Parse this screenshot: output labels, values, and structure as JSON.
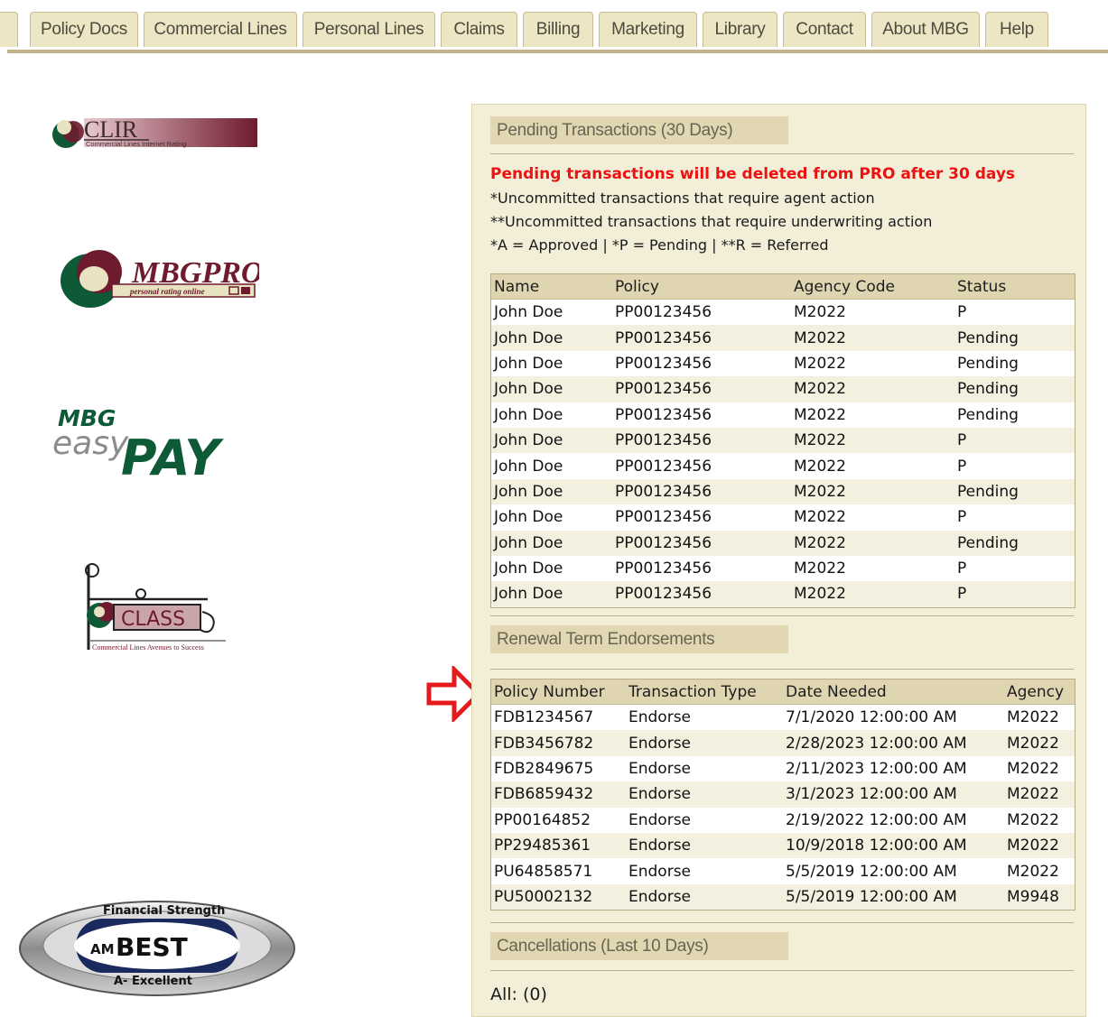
{
  "nav": {
    "tabs": [
      "Policy Docs",
      "Commercial Lines",
      "Personal Lines",
      "Claims",
      "Billing",
      "Marketing",
      "Library",
      "Contact",
      "About MBG",
      "Help"
    ]
  },
  "logos": {
    "clir": {
      "name": "CLIR",
      "tagline": "Commercial Lines Internet Rating"
    },
    "mbgpro": {
      "name": "MBGPRO",
      "tagline": "personal rating online"
    },
    "easypay": {
      "top": "MBG",
      "middle": "easy",
      "bottom": "PAY"
    },
    "class": {
      "name": "CLASS",
      "tagline": "Commercial Lines Avenues to Success"
    },
    "ambest": {
      "top": "Financial Strength",
      "name": "BEST",
      "bottom": "A- Excellent"
    }
  },
  "pending": {
    "title": "Pending Transactions (30 Days)",
    "warning": "Pending transactions will be deleted from PRO after 30 days",
    "note1": "*Uncommitted transactions that require agent action",
    "note2": "**Uncommitted transactions that require underwriting action",
    "note3": "*A = Approved | *P = Pending | **R = Referred",
    "columns": [
      "Name",
      "Policy",
      "Agency Code",
      "Status"
    ],
    "rows": [
      [
        "John Doe",
        "PP00123456",
        "M2022",
        "P"
      ],
      [
        "John Doe",
        "PP00123456",
        "M2022",
        "Pending"
      ],
      [
        "John Doe",
        "PP00123456",
        "M2022",
        "Pending"
      ],
      [
        "John Doe",
        "PP00123456",
        "M2022",
        "Pending"
      ],
      [
        "John Doe",
        "PP00123456",
        "M2022",
        "Pending"
      ],
      [
        "John Doe",
        "PP00123456",
        "M2022",
        "P"
      ],
      [
        "John Doe",
        "PP00123456",
        "M2022",
        "P"
      ],
      [
        "John Doe",
        "PP00123456",
        "M2022",
        "Pending"
      ],
      [
        "John Doe",
        "PP00123456",
        "M2022",
        "P"
      ],
      [
        "John Doe",
        "PP00123456",
        "M2022",
        "Pending"
      ],
      [
        "John Doe",
        "PP00123456",
        "M2022",
        "P"
      ],
      [
        "John Doe",
        "PP00123456",
        "M2022",
        "P"
      ]
    ]
  },
  "renewal": {
    "title": "Renewal Term Endorsements",
    "columns": [
      "Policy Number",
      "Transaction Type",
      "Date Needed",
      "Agency"
    ],
    "rows": [
      [
        "FDB1234567",
        "Endorse",
        "7/1/2020 12:00:00 AM",
        "M2022"
      ],
      [
        "FDB3456782",
        "Endorse",
        "2/28/2023 12:00:00 AM",
        "M2022"
      ],
      [
        "FDB2849675",
        "Endorse",
        "2/11/2023 12:00:00 AM",
        "M2022"
      ],
      [
        "FDB6859432",
        "Endorse",
        "3/1/2023 12:00:00 AM",
        "M2022"
      ],
      [
        "PP00164852",
        "Endorse",
        "2/19/2022 12:00:00 AM",
        "M2022"
      ],
      [
        "PP29485361",
        "Endorse",
        "10/9/2018 12:00:00 AM",
        "M2022"
      ],
      [
        "PU64858571",
        "Endorse",
        "5/5/2019 12:00:00 AM",
        "M2022"
      ],
      [
        "PU50002132",
        "Endorse",
        "5/5/2019 12:00:00 AM",
        "M9948"
      ]
    ]
  },
  "cancellations": {
    "title": "Cancellations (Last 10 Days)",
    "all_count": "All: (0)"
  },
  "colors": {
    "accent_red": "#ee1111",
    "panel_bg": "#f2eed8",
    "header_bg": "#dfd5b1",
    "brand_green": "#0e5a36",
    "brand_maroon": "#6e1b2d"
  }
}
